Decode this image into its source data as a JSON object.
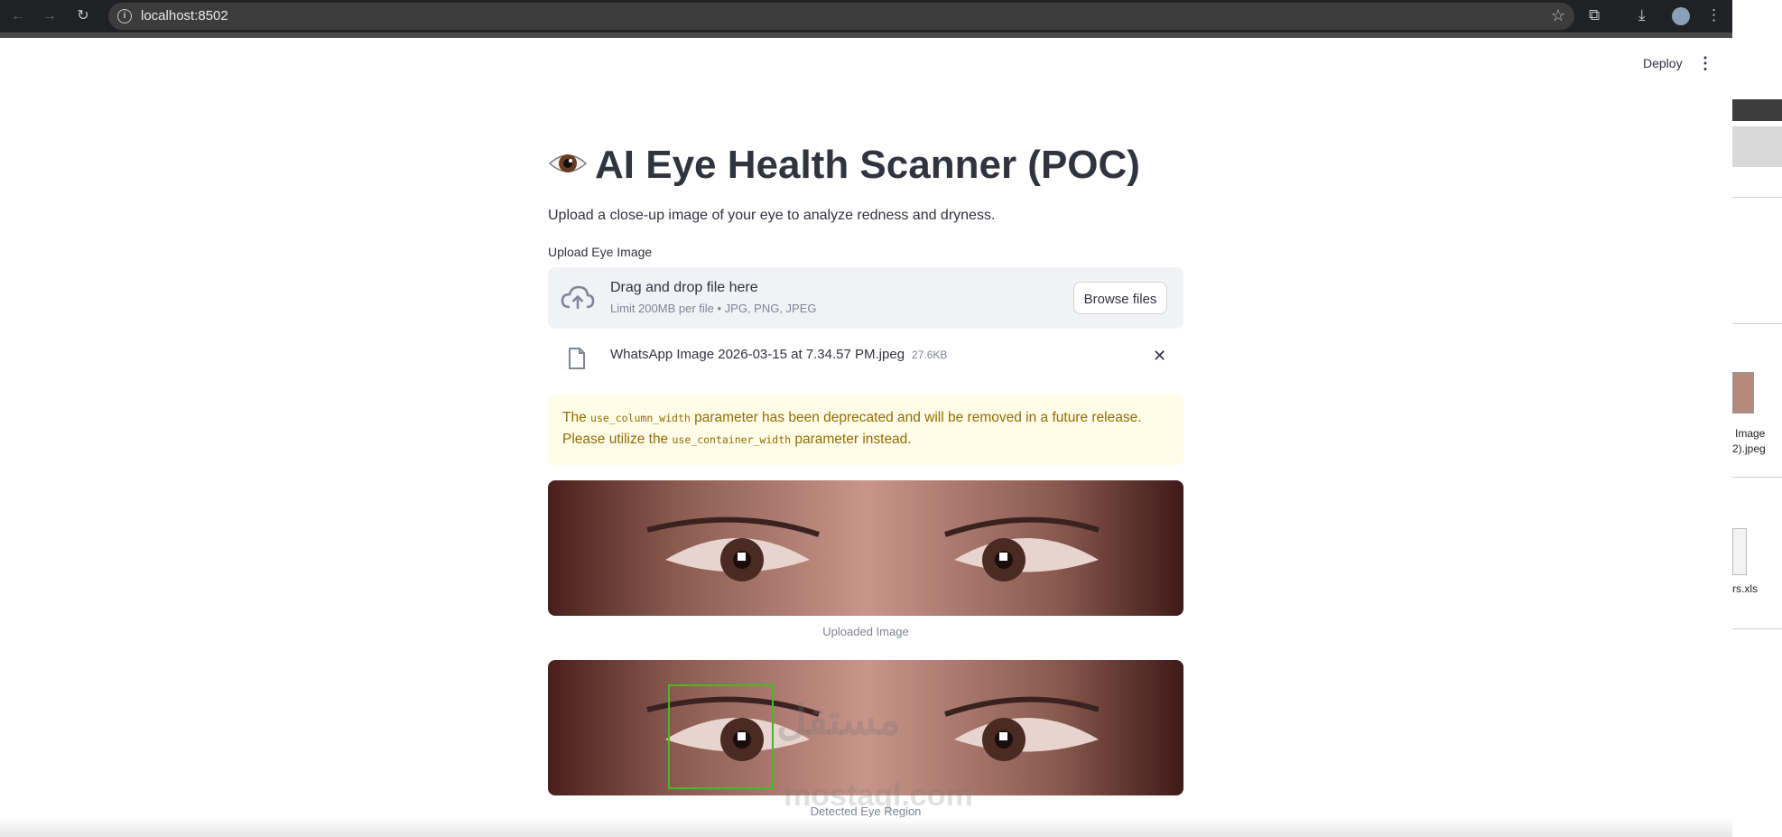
{
  "browser": {
    "url": "localhost:8502",
    "back_icon": "←",
    "forward_icon": "→",
    "reload_icon": "↻",
    "star_icon": "☆",
    "extensions_icon": "⧉",
    "download_icon": "⤓",
    "menu_icon": "⋮"
  },
  "header": {
    "deploy_label": "Deploy",
    "menu_icon": "⋮"
  },
  "page": {
    "title": "AI Eye Health Scanner (POC)",
    "subtitle": "Upload a close-up image of your eye to analyze redness and dryness."
  },
  "uploader": {
    "label": "Upload Eye Image",
    "drop_text": "Drag and drop file here",
    "limit_text": "Limit 200MB per file • JPG, PNG, JPEG",
    "browse_label": "Browse files"
  },
  "file": {
    "name": "WhatsApp Image 2026-03-15 at 7.34.57 PM.jpeg",
    "size": "27.6KB",
    "close_icon": "✕"
  },
  "warning": {
    "t1": "The ",
    "code1": "use_column_width",
    "t2": " parameter has been deprecated and will be removed in a future release. Please utilize the ",
    "code2": "use_container_width",
    "t3": " parameter instead."
  },
  "images": {
    "caption1": "Uploaded Image",
    "caption2": "Detected Eye Region"
  },
  "watermark": {
    "arabic": "مستقل",
    "latin": "mostaql.com"
  },
  "desktop": {
    "label1": "Image",
    "label2": "2).jpeg",
    "label3": "rs.xls"
  },
  "colors": {
    "warning_bg": "#fffce7",
    "warning_text": "#926c05",
    "detect_box": "#3fbf1f"
  }
}
